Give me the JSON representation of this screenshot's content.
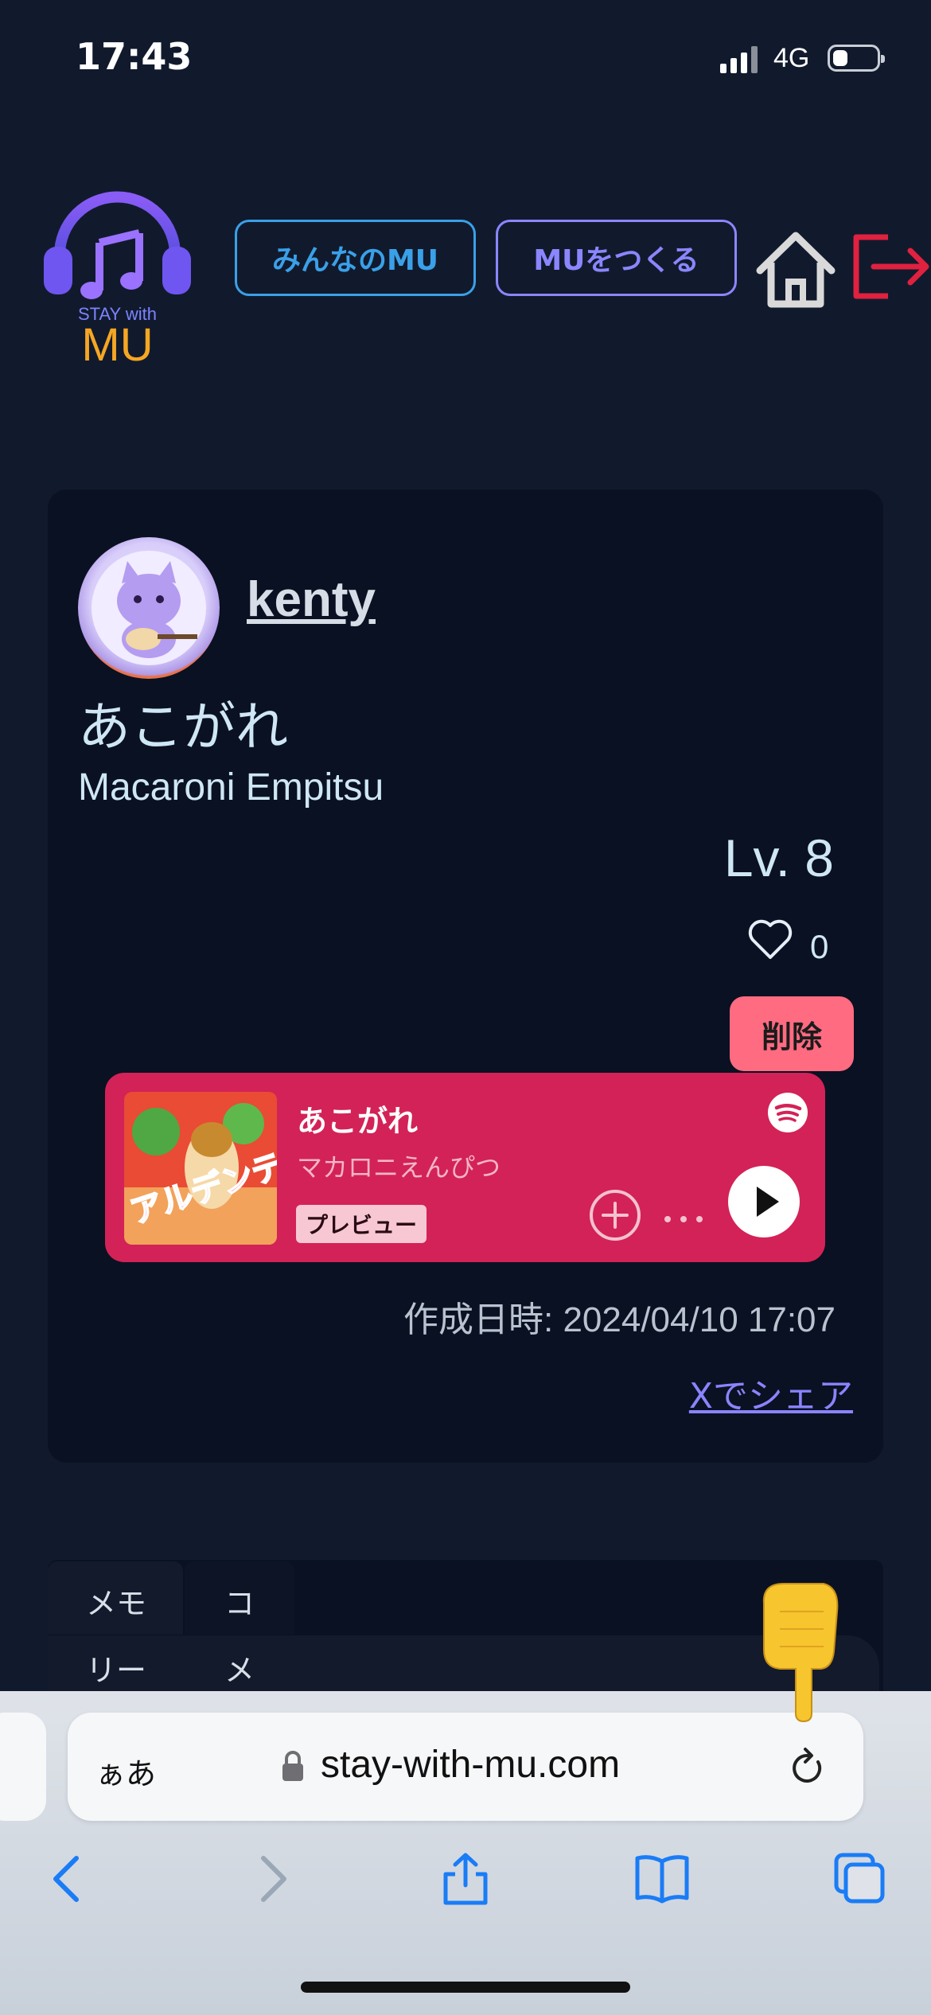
{
  "status_bar": {
    "time": "17:43",
    "network": "4G",
    "battery_level": 0.35
  },
  "header": {
    "logo": {
      "text_top": "STAY with",
      "text_bottom": "MU",
      "icon": "headphones-music-note-icon"
    },
    "everyone_button": "みんなのMU",
    "make_button": "MUをつくる",
    "home_icon": "home-icon",
    "logout_icon": "logout-icon"
  },
  "post": {
    "username": "kenty",
    "avatar_icon": "cat-guitar-avatar",
    "title": "あこがれ",
    "artist": "Macaroni Empitsu",
    "level": "Lv. 8",
    "likes": "0",
    "delete_button": "削除",
    "created_at": "作成日時: 2024/04/10 17:07",
    "share_link": "Xでシェア"
  },
  "embed": {
    "track_title": "あこがれ",
    "track_artist": "マカロニえんぴつ",
    "preview_label": "プレビュー",
    "album_art_text": "アルデンテ",
    "icons": [
      "spotify-icon",
      "add-circle-icon",
      "more-icon",
      "play-icon"
    ]
  },
  "tabs": {
    "items": [
      {
        "line1": "メモ",
        "line2": "リー"
      },
      {
        "line1": "コ",
        "line2": "メ"
      }
    ]
  },
  "browser": {
    "aa_label": "ぁあ",
    "url": "stay-with-mu.com",
    "icons": [
      "back-icon",
      "forward-icon",
      "share-icon",
      "bookmarks-icon",
      "tabs-icon"
    ]
  },
  "colors": {
    "background": "#111a2d",
    "card": "#0a1122",
    "accent_blue": "#3aa0e8",
    "accent_purple": "#8b86ff",
    "delete": "#ff6b81",
    "spotify_embed": "#d32257",
    "logo_orange": "#f5a623"
  }
}
